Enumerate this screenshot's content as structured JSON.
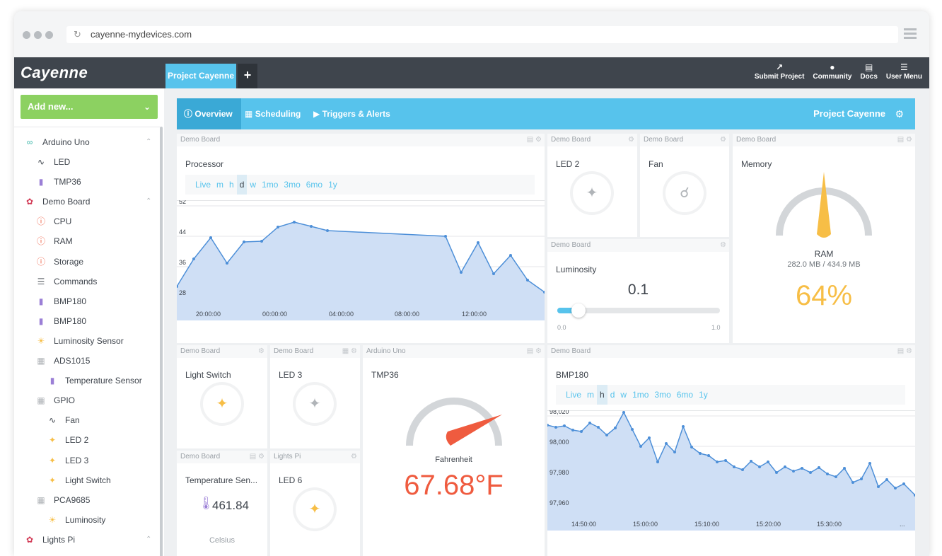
{
  "browser": {
    "url": "cayenne-mydevices.com"
  },
  "app": {
    "logo": "Cayenne",
    "project_tab": "Project Cayenne",
    "add_tab": "+",
    "topnav": [
      {
        "label": "Submit Project",
        "icon": "share-icon"
      },
      {
        "label": "Community",
        "icon": "chat-icon"
      },
      {
        "label": "Docs",
        "icon": "document-icon"
      },
      {
        "label": "User Menu",
        "icon": "hamburger-icon"
      }
    ]
  },
  "sidebar": {
    "add_new": "Add new...",
    "items": [
      {
        "label": "Arduino Uno",
        "icon": "arduino-icon",
        "level": 0,
        "caret": true
      },
      {
        "label": "LED",
        "icon": "digital-signal-icon",
        "level": 1
      },
      {
        "label": "TMP36",
        "icon": "thermometer-icon",
        "level": 1
      },
      {
        "label": "Demo Board",
        "icon": "raspberry-icon",
        "level": 0,
        "caret": true
      },
      {
        "label": "CPU",
        "icon": "info-icon",
        "level": 1
      },
      {
        "label": "RAM",
        "icon": "info-icon",
        "level": 1
      },
      {
        "label": "Storage",
        "icon": "info-icon",
        "level": 1
      },
      {
        "label": "Commands",
        "icon": "list-icon",
        "level": 1
      },
      {
        "label": "BMP180",
        "icon": "thermometer-icon",
        "level": 1
      },
      {
        "label": "BMP180",
        "icon": "thermometer-icon",
        "level": 1
      },
      {
        "label": "Luminosity Sensor",
        "icon": "sun-icon",
        "level": 1
      },
      {
        "label": "ADS1015",
        "icon": "chip-icon",
        "level": 1
      },
      {
        "label": "Temperature Sensor",
        "icon": "thermometer-icon",
        "level": 2
      },
      {
        "label": "GPIO",
        "icon": "chip-icon",
        "level": 1
      },
      {
        "label": "Fan",
        "icon": "digital-signal-icon",
        "level": 2
      },
      {
        "label": "LED 2",
        "icon": "bulb-icon",
        "level": 2
      },
      {
        "label": "LED 3",
        "icon": "bulb-icon",
        "level": 2
      },
      {
        "label": "Light Switch",
        "icon": "bulb-icon",
        "level": 2
      },
      {
        "label": "PCA9685",
        "icon": "chip-icon",
        "level": 1
      },
      {
        "label": "Luminosity",
        "icon": "sun-icon",
        "level": 2
      },
      {
        "label": "Lights Pi",
        "icon": "raspberry-icon",
        "level": 0,
        "caret": true
      }
    ]
  },
  "subbar": {
    "tabs": [
      {
        "label": "Overview",
        "icon": "info-icon"
      },
      {
        "label": "Scheduling",
        "icon": "calendar-icon"
      },
      {
        "label": "Triggers & Alerts",
        "icon": "play-icon"
      }
    ],
    "project_title": "Project Cayenne"
  },
  "widgets": {
    "processor": {
      "board": "Demo Board",
      "title": "Processor",
      "ranges": [
        "Live",
        "m",
        "h",
        "d",
        "w",
        "1mo",
        "3mo",
        "6mo",
        "1y"
      ],
      "selected": "d",
      "y_ticks": [
        "52",
        "44",
        "36",
        "28"
      ],
      "x_ticks": [
        "20:00:00",
        "00:00:00",
        "04:00:00",
        "08:00:00",
        "12:00:00"
      ]
    },
    "led2": {
      "board": "Demo Board",
      "title": "LED 2",
      "state": "off"
    },
    "fan": {
      "board": "Demo Board",
      "title": "Fan",
      "state": "off"
    },
    "memory": {
      "board": "Demo Board",
      "title": "Memory",
      "label": "RAM",
      "detail": "282.0 MB / 434.9 MB",
      "value": "64%",
      "fraction": 0.64
    },
    "luminosity": {
      "board": "Demo Board",
      "title": "Luminosity",
      "value": "0.1",
      "min": "0.0",
      "max": "1.0",
      "fraction": 0.1
    },
    "light_switch": {
      "board": "Demo Board",
      "title": "Light Switch",
      "state": "on"
    },
    "led3": {
      "board": "Demo Board",
      "title": "LED 3",
      "state": "off"
    },
    "tmp36": {
      "board": "Arduino Uno",
      "title": "TMP36",
      "unit_label": "Fahrenheit",
      "value": "67.68°F"
    },
    "bmp180": {
      "board": "Demo Board",
      "title": "BMP180",
      "ranges": [
        "Live",
        "m",
        "h",
        "d",
        "w",
        "1mo",
        "3mo",
        "6mo",
        "1y"
      ],
      "selected": "h",
      "y_ticks": [
        "98,020",
        "98,000",
        "97,980",
        "97,960"
      ],
      "x_ticks": [
        "14:50:00",
        "15:00:00",
        "15:10:00",
        "15:20:00",
        "15:30:00",
        "..."
      ]
    },
    "temp_sensor": {
      "board": "Demo Board",
      "title": "Temperature Sen...",
      "value": "461.84",
      "unit": "Celsius"
    },
    "led6": {
      "board": "Lights Pi",
      "title": "LED 6",
      "state": "on"
    }
  },
  "colors": {
    "accent": "#57c3ec",
    "gauge": "#f7be46",
    "danger": "#ef5b3f",
    "chart_fill": "#cfdff5",
    "chart_line": "#4d8fd8"
  }
}
